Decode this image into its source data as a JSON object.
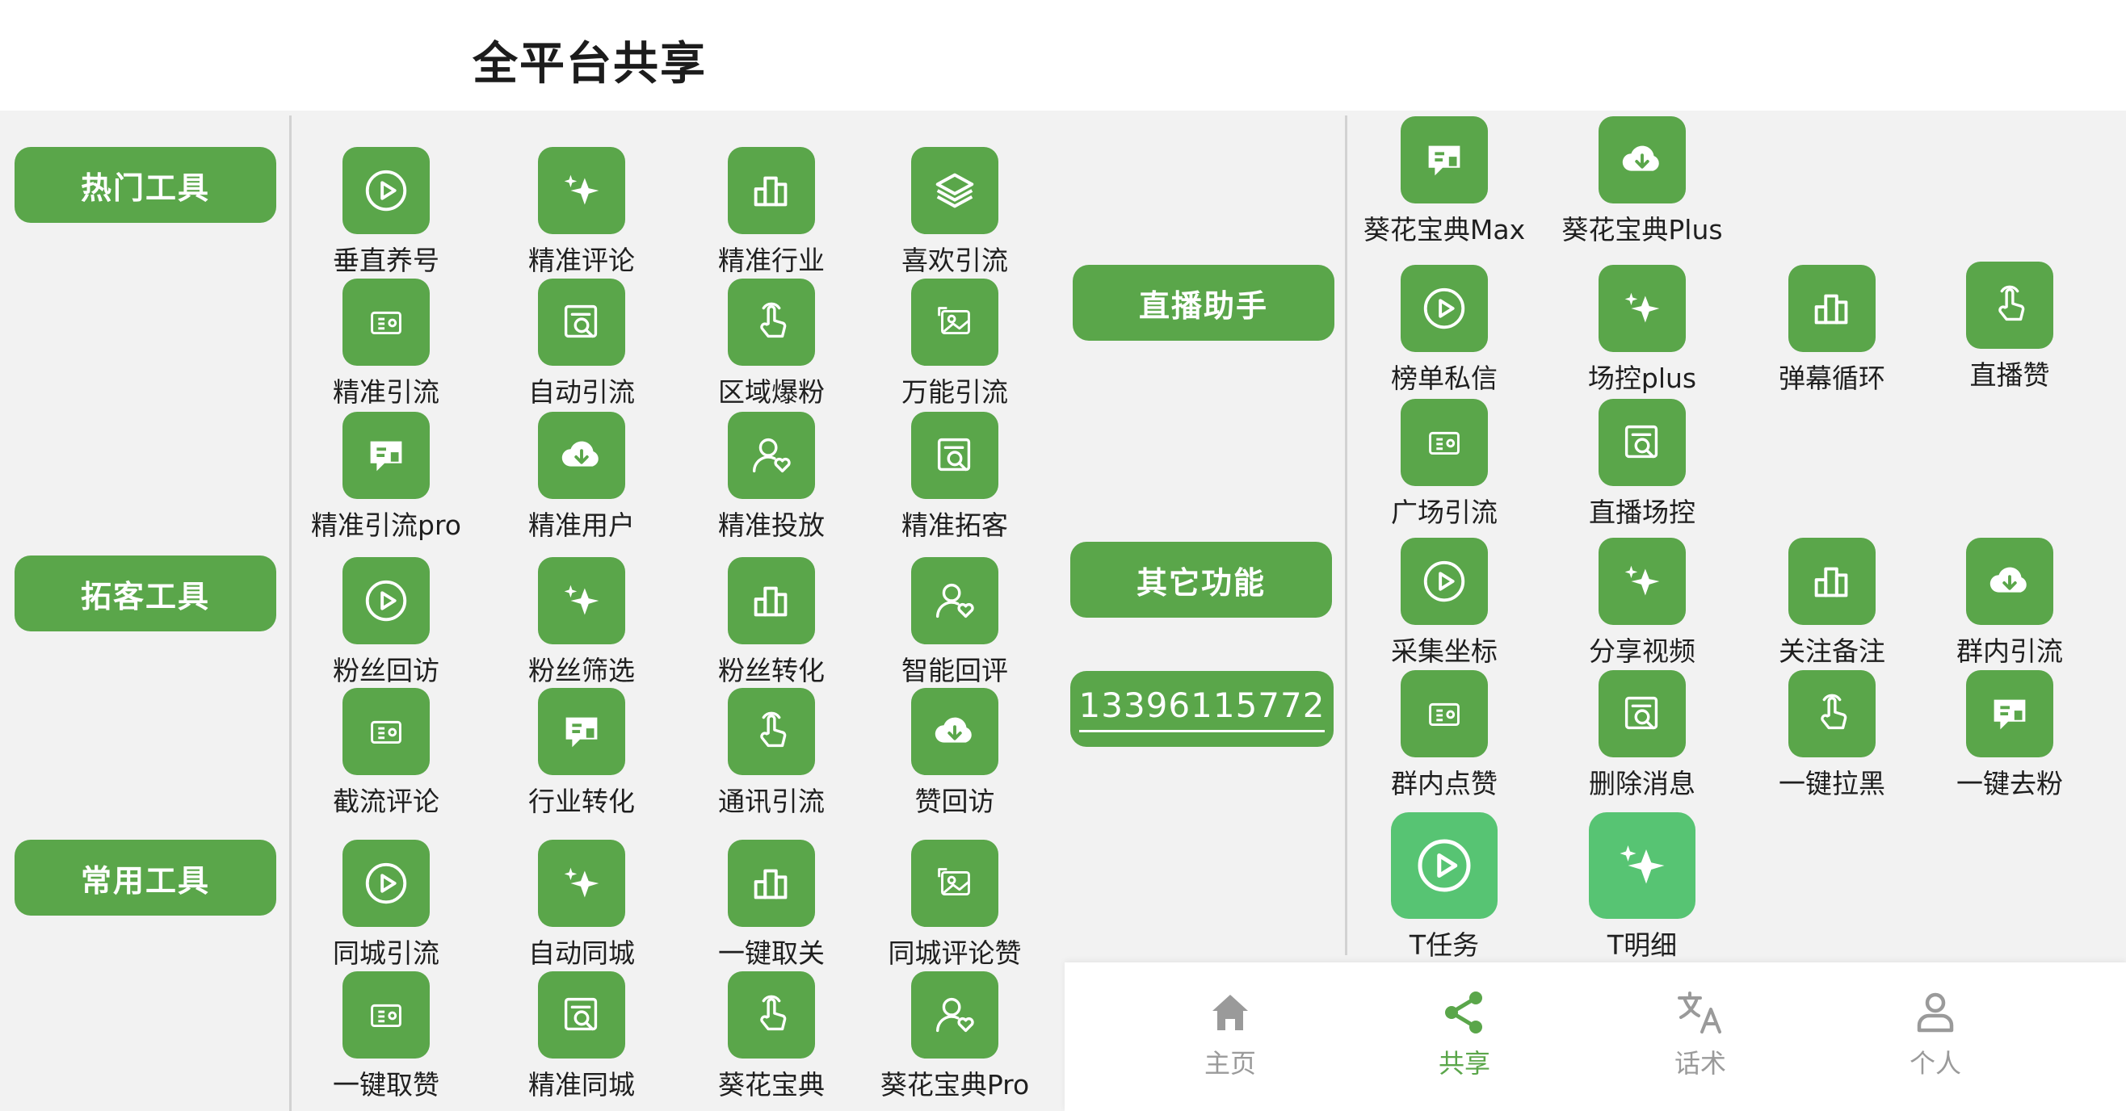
{
  "page_title": "全平台共享",
  "colors": {
    "accent": "#5aa64a",
    "accent_bright": "#57c473",
    "nav_inactive": "#9a9a9a",
    "panel_bg": "#f2f2f2"
  },
  "categories_left": [
    "热门工具",
    "拓客工具",
    "常用工具"
  ],
  "categories_right": [
    "直播助手",
    "其它功能"
  ],
  "phone": "13396115772",
  "left_tools": [
    {
      "label": "垂直养号",
      "icon": "play-icon"
    },
    {
      "label": "精准评论",
      "icon": "sparkle-icon"
    },
    {
      "label": "精准行业",
      "icon": "bar-chart-icon"
    },
    {
      "label": "喜欢引流",
      "icon": "layers-icon"
    },
    {
      "label": "精准引流",
      "icon": "card-icon"
    },
    {
      "label": "自动引流",
      "icon": "doc-search-icon"
    },
    {
      "label": "区域爆粉",
      "icon": "tap-icon"
    },
    {
      "label": "万能引流",
      "icon": "image-icon"
    },
    {
      "label": "精准引流pro",
      "icon": "thumb-chat-icon"
    },
    {
      "label": "精准用户",
      "icon": "cloud-download-icon"
    },
    {
      "label": "精准投放",
      "icon": "user-heart-icon"
    },
    {
      "label": "精准拓客",
      "icon": "doc-search-icon"
    },
    {
      "label": "粉丝回访",
      "icon": "play-icon"
    },
    {
      "label": "粉丝筛选",
      "icon": "sparkle-icon"
    },
    {
      "label": "粉丝转化",
      "icon": "bar-chart-icon"
    },
    {
      "label": "智能回评",
      "icon": "user-heart-icon"
    },
    {
      "label": "截流评论",
      "icon": "card-icon"
    },
    {
      "label": "行业转化",
      "icon": "thumb-chat-icon"
    },
    {
      "label": "通讯引流",
      "icon": "tap-icon"
    },
    {
      "label": "赞回访",
      "icon": "cloud-download-icon"
    },
    {
      "label": "同城引流",
      "icon": "play-icon"
    },
    {
      "label": "自动同城",
      "icon": "sparkle-icon"
    },
    {
      "label": "一键取关",
      "icon": "bar-chart-icon"
    },
    {
      "label": "同城评论赞",
      "icon": "image-icon"
    },
    {
      "label": "一键取赞",
      "icon": "card-icon"
    },
    {
      "label": "精准同城",
      "icon": "doc-search-icon"
    },
    {
      "label": "葵花宝典",
      "icon": "tap-icon"
    },
    {
      "label": "葵花宝典Pro",
      "icon": "user-heart-icon"
    }
  ],
  "right_tools": [
    {
      "label": "葵花宝典Max",
      "icon": "thumb-chat-icon"
    },
    {
      "label": "葵花宝典Plus",
      "icon": "cloud-download-icon"
    },
    {
      "label": "榜单私信",
      "icon": "play-icon"
    },
    {
      "label": "场控plus",
      "icon": "sparkle-icon"
    },
    {
      "label": "弹幕循环",
      "icon": "bar-chart-icon"
    },
    {
      "label": "直播赞",
      "icon": "tap-icon"
    },
    {
      "label": "广场引流",
      "icon": "card-icon"
    },
    {
      "label": "直播场控",
      "icon": "doc-search-icon"
    },
    {
      "label": "采集坐标",
      "icon": "play-icon"
    },
    {
      "label": "分享视频",
      "icon": "sparkle-icon"
    },
    {
      "label": "关注备注",
      "icon": "bar-chart-icon"
    },
    {
      "label": "群内引流",
      "icon": "cloud-download-icon"
    },
    {
      "label": "群内点赞",
      "icon": "card-icon"
    },
    {
      "label": "删除消息",
      "icon": "doc-search-icon"
    },
    {
      "label": "一键拉黑",
      "icon": "tap-icon"
    },
    {
      "label": "一键去粉",
      "icon": "thumb-chat-icon"
    },
    {
      "label": "T任务",
      "icon": "play-icon"
    },
    {
      "label": "T明细",
      "icon": "sparkle-icon"
    }
  ],
  "bottom_nav": [
    {
      "label": "主页",
      "icon": "home-icon",
      "active": false
    },
    {
      "label": "共享",
      "icon": "share-icon",
      "active": true
    },
    {
      "label": "话术",
      "icon": "translate-icon",
      "active": false
    },
    {
      "label": "个人",
      "icon": "person-icon",
      "active": false
    }
  ]
}
